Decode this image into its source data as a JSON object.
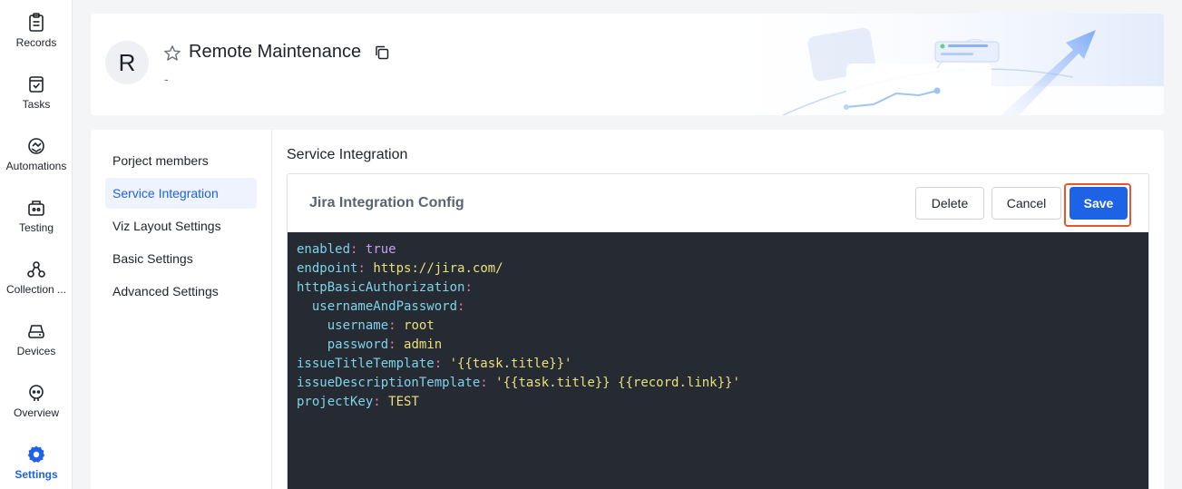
{
  "rail": {
    "items": [
      {
        "label": "Records",
        "icon": "clipboard-icon"
      },
      {
        "label": "Tasks",
        "icon": "task-check-icon"
      },
      {
        "label": "Automations",
        "icon": "automation-icon"
      },
      {
        "label": "Testing",
        "icon": "testing-icon"
      },
      {
        "label": "Collection ...",
        "icon": "collection-icon"
      },
      {
        "label": "Devices",
        "icon": "device-icon"
      },
      {
        "label": "Overview",
        "icon": "overview-icon"
      },
      {
        "label": "Settings",
        "icon": "gear-icon"
      }
    ],
    "active": "Settings",
    "active_color": "#1e62e6"
  },
  "header": {
    "avatar_letter": "R",
    "title": "Remote Maintenance",
    "subtitle": "-"
  },
  "sidenav": {
    "items": [
      {
        "label": "Porject members"
      },
      {
        "label": "Service Integration"
      },
      {
        "label": "Viz Layout Settings"
      },
      {
        "label": "Basic Settings"
      },
      {
        "label": "Advanced Settings"
      }
    ],
    "active": "Service Integration"
  },
  "section": {
    "title": "Service Integration"
  },
  "config": {
    "title": "Jira Integration Config",
    "delete_label": "Delete",
    "cancel_label": "Cancel",
    "save_label": "Save",
    "primary_color": "#1e62e6",
    "highlight_color": "#e4572e"
  },
  "code": {
    "lines": [
      {
        "indent": "",
        "key": "enabled",
        "value": "true",
        "type": "bool"
      },
      {
        "indent": "",
        "key": "endpoint",
        "value": "https://jira.com/",
        "type": "str"
      },
      {
        "indent": "",
        "key": "httpBasicAuthorization",
        "value": "",
        "type": "none"
      },
      {
        "indent": "  ",
        "key": "usernameAndPassword",
        "value": "",
        "type": "none"
      },
      {
        "indent": "    ",
        "key": "username",
        "value": "root",
        "type": "str"
      },
      {
        "indent": "    ",
        "key": "password",
        "value": "admin",
        "type": "str"
      },
      {
        "indent": "",
        "key": "issueTitleTemplate",
        "value": "'{{task.title}}'",
        "type": "str"
      },
      {
        "indent": "",
        "key": "issueDescriptionTemplate",
        "value": "'{{task.title}} {{record.link}}'",
        "type": "str"
      },
      {
        "indent": "",
        "key": "projectKey",
        "value": "TEST",
        "type": "str"
      }
    ]
  }
}
